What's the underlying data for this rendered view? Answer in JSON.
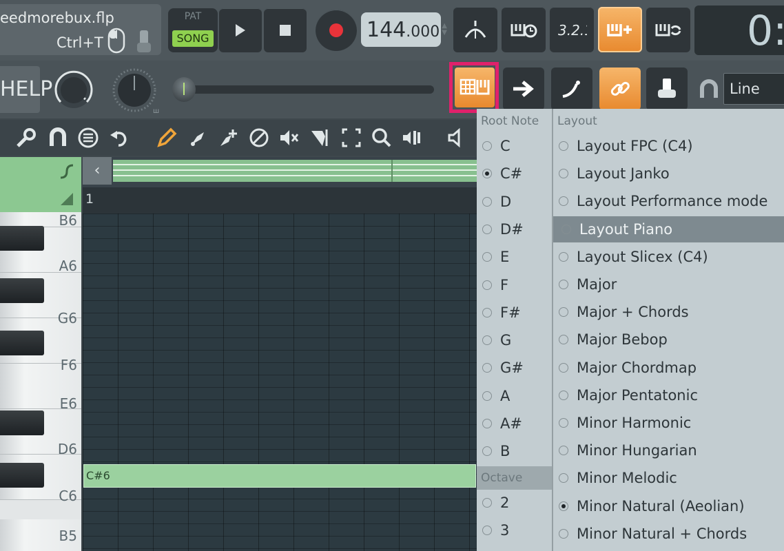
{
  "file": {
    "name": "eedmorebux.flp",
    "shortcut": "Ctrl+T"
  },
  "transport": {
    "pat_label": "PAT",
    "song_label": "SONG",
    "tempo_int": "144",
    "tempo_dec": ".000",
    "time": "0:"
  },
  "help_label": "HELP",
  "snap_select": "Line",
  "ruler_bar": "1",
  "note_label": "C#6",
  "keys": {
    "b6": "B6",
    "a6": "A6",
    "g6": "G6",
    "f6": "F6",
    "e6": "E6",
    "d6": "D6",
    "c6": "C6",
    "b5": "B5"
  },
  "panel": {
    "root_header": "Root Note",
    "layout_header": "Layout",
    "octave_header": "Octave",
    "root_notes": [
      "C",
      "C#",
      "D",
      "D#",
      "E",
      "F",
      "F#",
      "G",
      "G#",
      "A",
      "A#",
      "B"
    ],
    "root_selected": "C#",
    "octaves": [
      "2",
      "3"
    ],
    "layouts": [
      "Layout FPC (C4)",
      "Layout Janko",
      "Layout Performance mode",
      "Layout Piano",
      "Layout Slicex (C4)",
      "Major",
      "Major + Chords",
      "Major Bebop",
      "Major Chordmap",
      "Major Pentatonic",
      "Minor Harmonic",
      "Minor Hungarian",
      "Minor Melodic",
      "Minor Natural (Aeolian)",
      "Minor Natural + Chords"
    ],
    "layout_highlighted": "Layout Piano",
    "layout_selected": "Minor Natural (Aeolian)"
  },
  "colors": {
    "accent_orange": "#e8892e",
    "highlight_magenta": "#e0216b",
    "note_green": "#9bd19f",
    "song_green": "#8fd04f"
  }
}
